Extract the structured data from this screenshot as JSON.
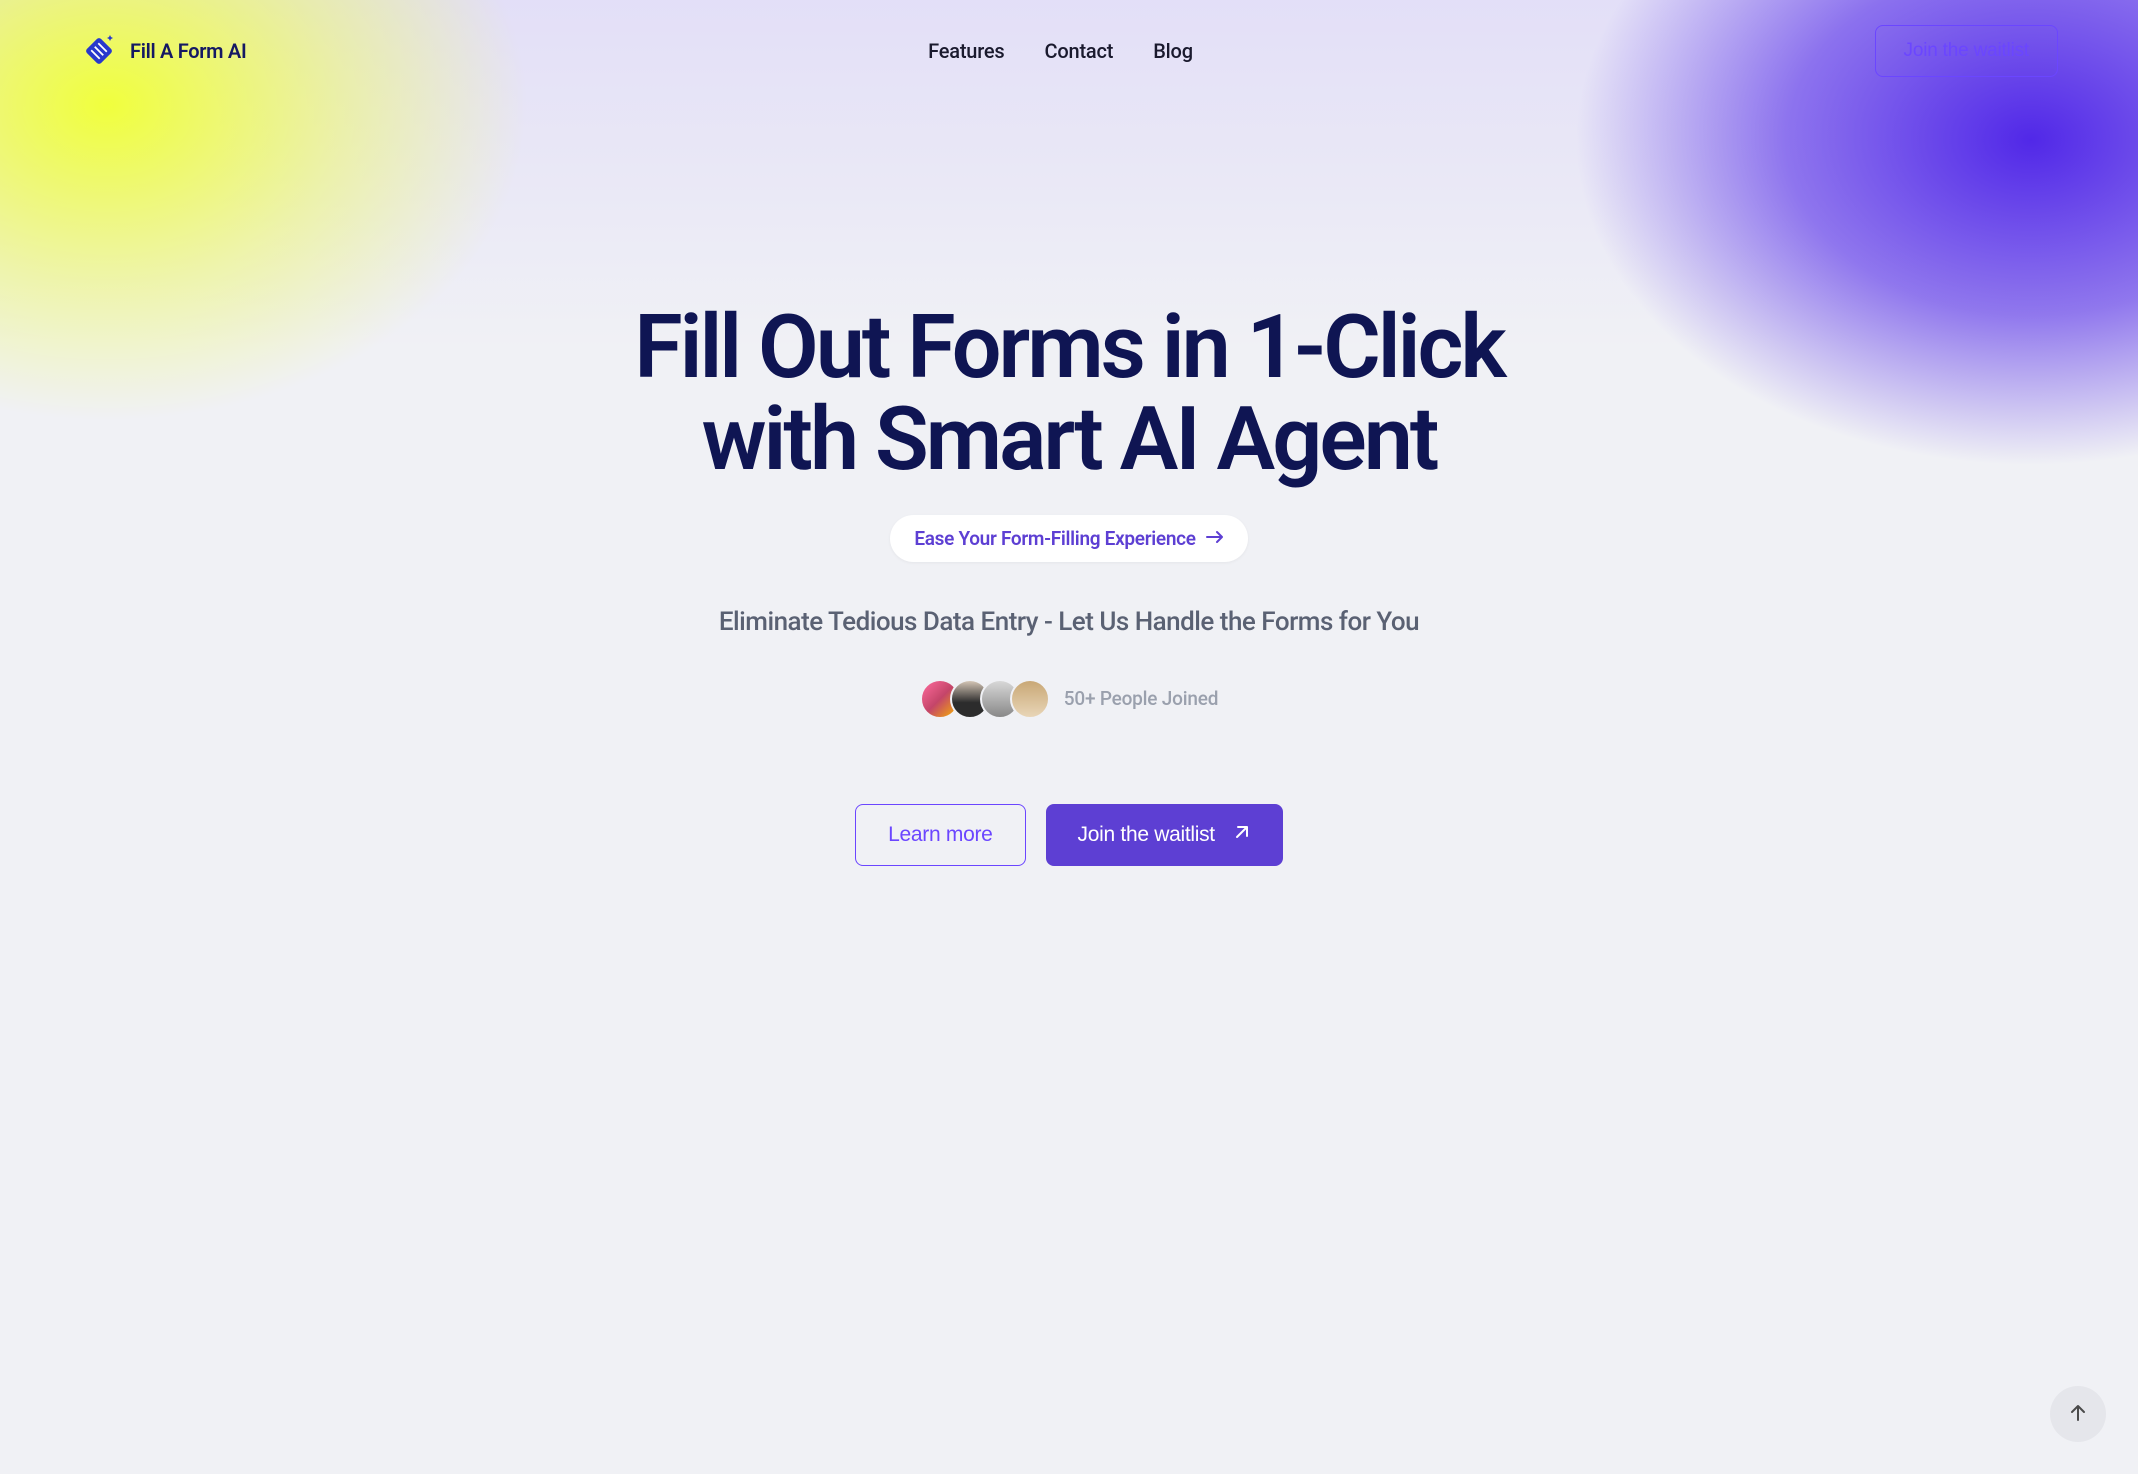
{
  "header": {
    "brand": "Fill A Form AI",
    "nav": {
      "features": "Features",
      "contact": "Contact",
      "blog": "Blog"
    },
    "cta": "Join the waitlist"
  },
  "hero": {
    "title": "Fill Out Forms in 1-Click with Smart AI Agent",
    "ease_pill": "Ease Your Form-Filling Experience",
    "subheading": "Eliminate Tedious Data Entry - Let Us Handle the Forms for You",
    "social_proof": "50+ People Joined",
    "learn_more": "Learn more",
    "join_waitlist": "Join the waitlist"
  }
}
